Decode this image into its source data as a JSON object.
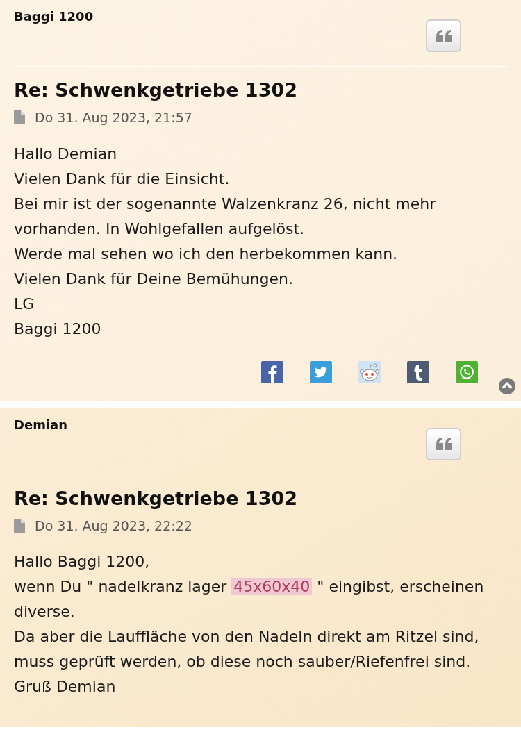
{
  "posts": [
    {
      "author": "Baggi 1200",
      "title": "Re: Schwenkgetriebe 1302",
      "date": "Do 31. Aug 2023, 21:57",
      "divider": true,
      "body": [
        "Hallo Demian",
        "Vielen Dank für die Einsicht.",
        "Bei mir ist der sogenannte Walzenkranz 26, nicht mehr vorhanden. In Wohlgefallen aufgelöst.",
        "Werde mal sehen wo ich den herbekommen kann.",
        "Vielen Dank für Deine Bemühungen.",
        "LG",
        "Baggi 1200"
      ],
      "share_buttons": [
        {
          "kind": "facebook"
        },
        {
          "kind": "twitter"
        },
        {
          "kind": "reddit"
        },
        {
          "kind": "tumblr"
        },
        {
          "kind": "whatsapp"
        }
      ],
      "back_to_top": true
    },
    {
      "author": "Demian",
      "title": "Re: Schwenkgetriebe 1302",
      "date": "Do 31. Aug 2023, 22:22",
      "divider": false,
      "body": [
        "Hallo Baggi 1200,",
        {
          "segments": [
            {
              "kind": "plain",
              "text": "wenn Du \" nadelkranz lager "
            },
            {
              "kind": "code",
              "text": "45x60x40"
            },
            {
              "kind": "plain",
              "text": " \" eingibst, erscheinen diverse."
            }
          ]
        },
        "Da aber die Lauffläche von den Nadeln direkt am Ritzel sind, muss geprüft werden, ob diese noch sauber/Riefenfrei sind.",
        "Gruß Demian"
      ],
      "back_to_top": false
    }
  ]
}
